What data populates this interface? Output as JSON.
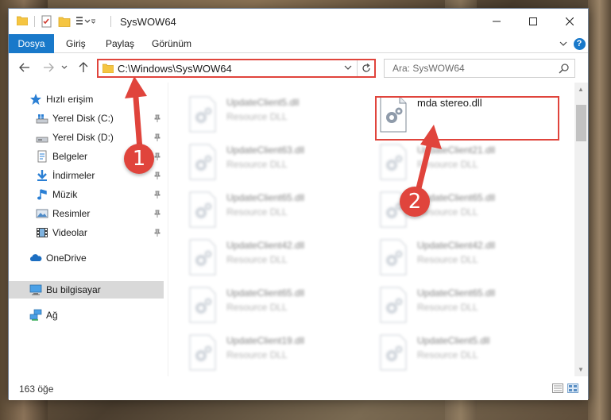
{
  "window": {
    "title": "SysWOW64",
    "controls": {
      "minimize": "minimize-icon",
      "maximize": "maximize-icon",
      "close": "close-icon"
    }
  },
  "ribbon": {
    "tabs": [
      {
        "label": "Dosya",
        "active": true
      },
      {
        "label": "Giriş"
      },
      {
        "label": "Paylaş"
      },
      {
        "label": "Görünüm"
      }
    ]
  },
  "nav": {
    "address": "C:\\Windows\\SysWOW64",
    "search_placeholder": "Ara: SysWOW64"
  },
  "sidebar": {
    "items": [
      {
        "label": "Hızlı erişim",
        "icon": "star-icon"
      },
      {
        "label": "Yerel Disk (C:)",
        "icon": "drive-icon",
        "pinned": true
      },
      {
        "label": "Yerel Disk (D:)",
        "icon": "drive-icon",
        "pinned": true
      },
      {
        "label": "Belgeler",
        "icon": "documents-icon",
        "pinned": true
      },
      {
        "label": "İndirmeler",
        "icon": "download-icon",
        "pinned": true
      },
      {
        "label": "Müzik",
        "icon": "music-icon",
        "pinned": true
      },
      {
        "label": "Resimler",
        "icon": "pictures-icon",
        "pinned": true
      },
      {
        "label": "Videolar",
        "icon": "videos-icon",
        "pinned": true
      },
      {
        "label": "OneDrive",
        "icon": "cloud-icon"
      },
      {
        "label": "Bu bilgisayar",
        "icon": "computer-icon",
        "selected": true
      },
      {
        "label": "Ağ",
        "icon": "network-icon"
      }
    ]
  },
  "files": {
    "left": [
      {
        "name": "UpdateClient5.dll",
        "type": "Resource DLL"
      },
      {
        "name": "UpdateClient63.dll",
        "type": "Resource DLL"
      },
      {
        "name": "UpdateClient65.dll",
        "type": "Resource DLL"
      },
      {
        "name": "UpdateClient42.dll",
        "type": "Resource DLL"
      },
      {
        "name": "UpdateClient65.dll",
        "type": "Resource DLL"
      },
      {
        "name": "UpdateClient19.dll",
        "type": "Resource DLL"
      }
    ],
    "right": [
      {
        "name": "mda stereo.dll",
        "type": "",
        "highlighted": true
      },
      {
        "name": "UpdateClient21.dll",
        "type": "Resource DLL"
      },
      {
        "name": "UpdateClient65.dll",
        "type": "Resource DLL"
      },
      {
        "name": "UpdateClient42.dll",
        "type": "Resource DLL"
      },
      {
        "name": "UpdateClient65.dll",
        "type": "Resource DLL"
      },
      {
        "name": "UpdateClient5.dll",
        "type": "Resource DLL"
      }
    ]
  },
  "status": {
    "item_count": "163 öğe"
  },
  "annotations": {
    "step1": "1",
    "step2": "2"
  },
  "colors": {
    "accent": "#1979ca",
    "annotation": "#e0443c"
  }
}
